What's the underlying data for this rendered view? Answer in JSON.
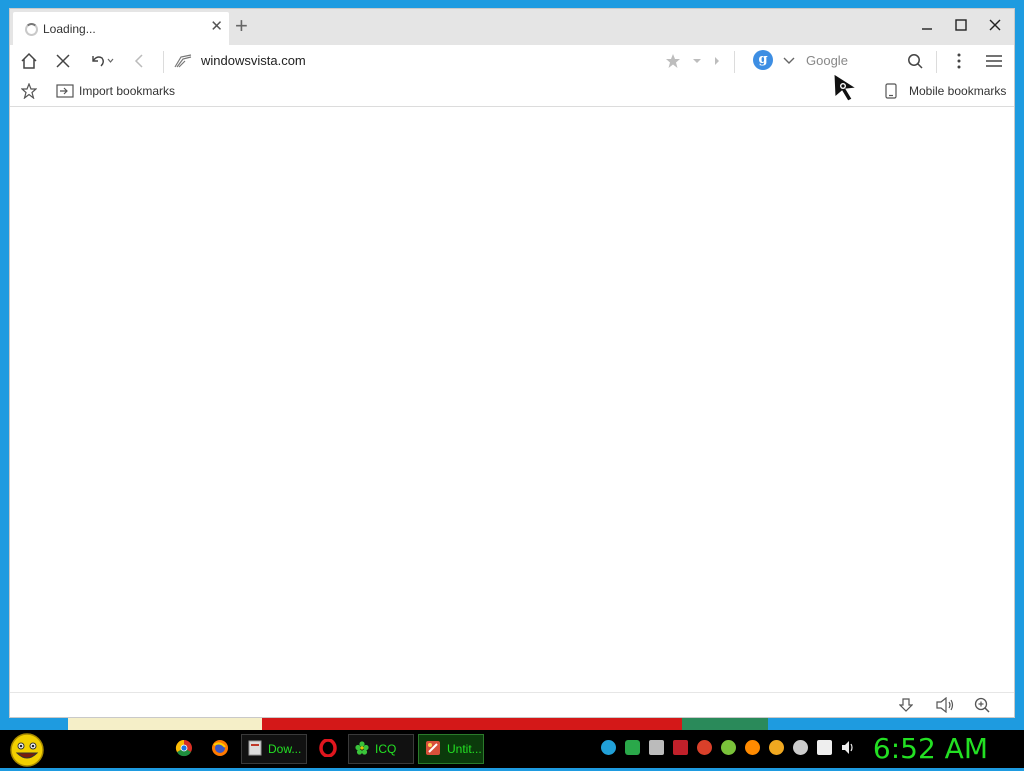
{
  "browser": {
    "tab_title": "Loading...",
    "url": "windowsvista.com",
    "search_engine": "Google",
    "bookmarks_bar": {
      "import_label": "Import bookmarks",
      "mobile_label": "Mobile bookmarks"
    }
  },
  "taskbar": {
    "buttons": [
      {
        "label": "Dow...",
        "icon": "document-icon"
      },
      {
        "label": "ICQ",
        "icon": "icq-flower-icon"
      },
      {
        "label": "Untit...",
        "icon": "paint-icon"
      }
    ],
    "pinned": [
      "chrome-icon",
      "firefox-icon",
      "opera-icon"
    ],
    "clock": "6:52 AM"
  },
  "colors": {
    "desktop": "#1e9be0",
    "taskbar": "#000000",
    "clock": "#23e023",
    "search_badge": "#3d8ee3"
  }
}
